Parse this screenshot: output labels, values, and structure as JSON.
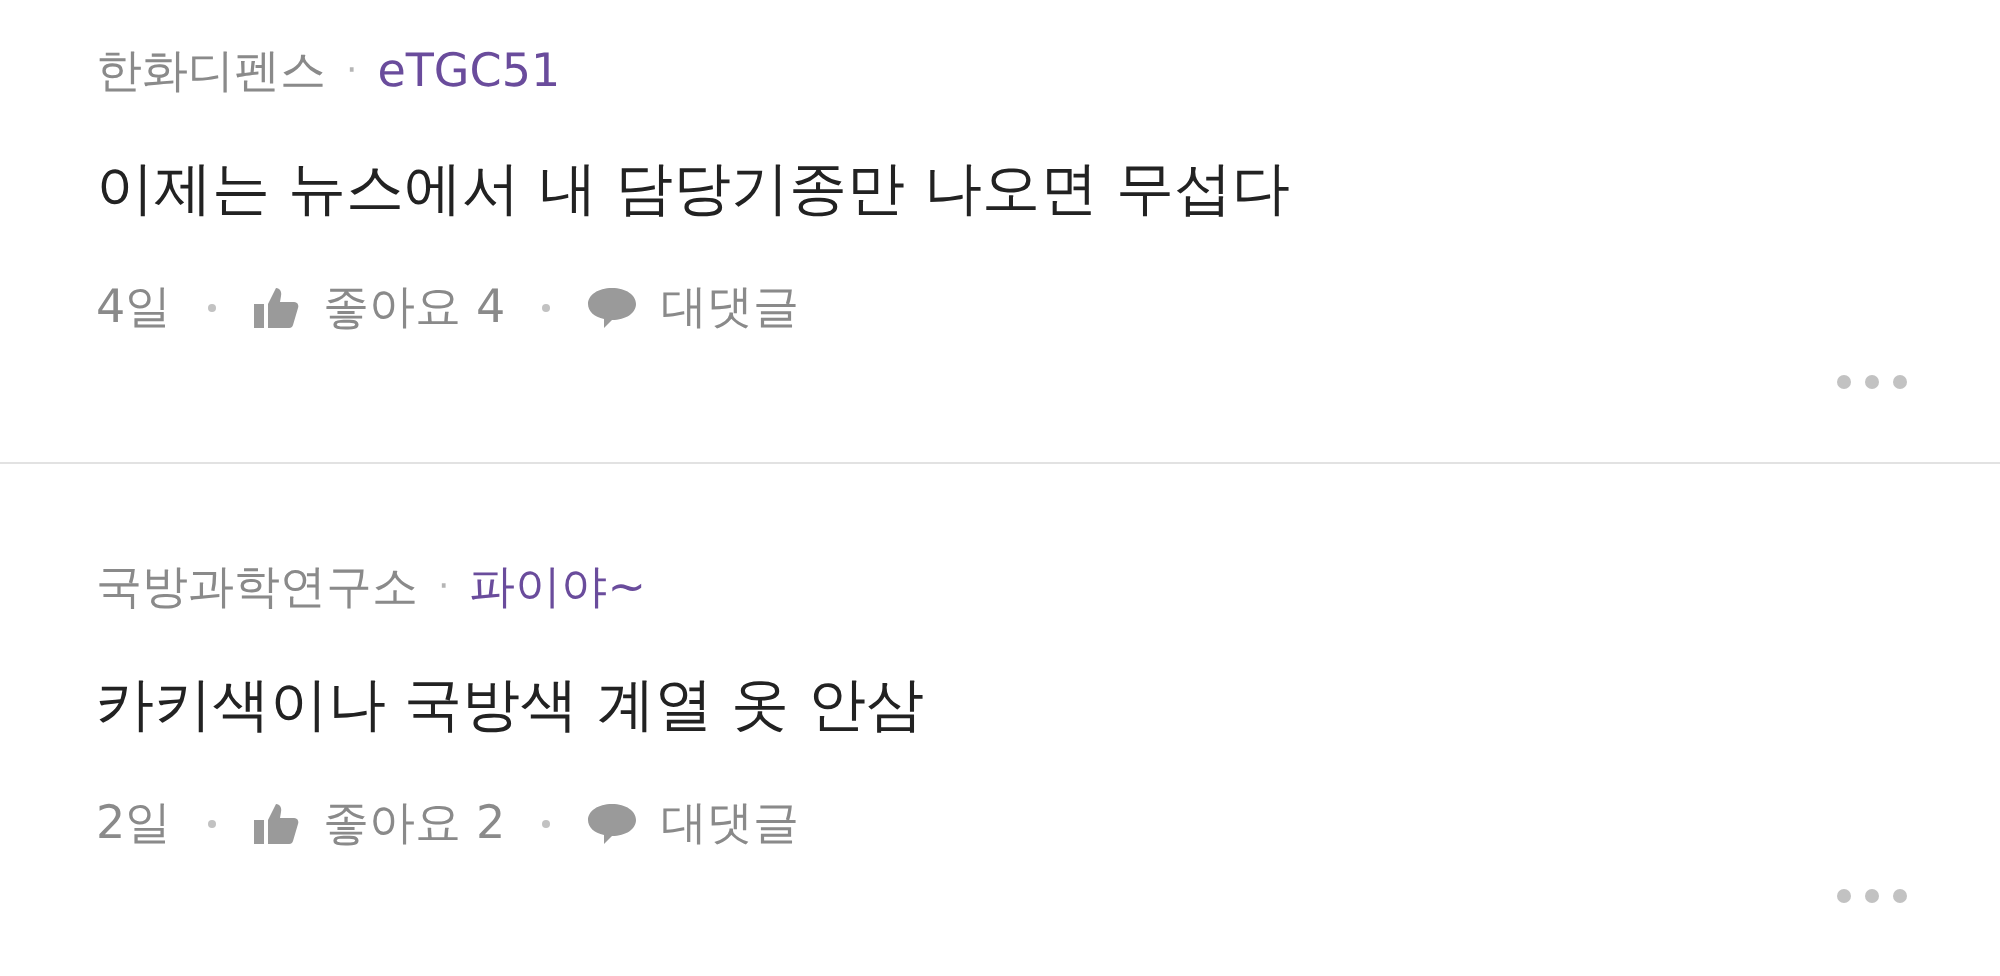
{
  "comments": [
    {
      "company": "한화디펜스",
      "separator": "·",
      "nickname": "eTGC51",
      "body": "이제는 뉴스에서 내 담당기종만 나오면 무섭다",
      "time": "4일",
      "like_label": "좋아요 4",
      "reply_label": "대댓글"
    },
    {
      "company": "국방과학연구소",
      "separator": "·",
      "nickname": "파이야~",
      "body": "카키색이나 국방색 계열 옷 안삼",
      "time": "2일",
      "like_label": "좋아요 2",
      "reply_label": "대댓글"
    }
  ]
}
